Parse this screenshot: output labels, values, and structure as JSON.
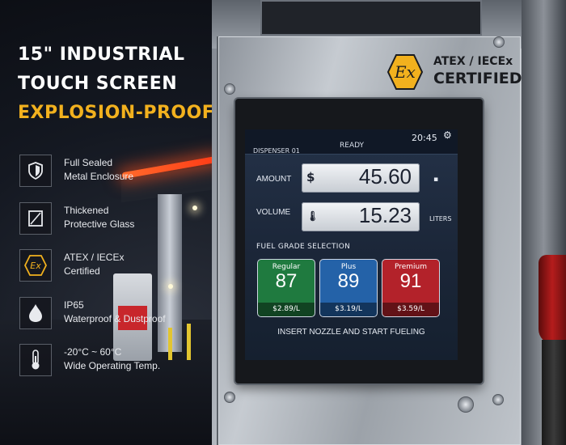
{
  "headline": {
    "line1": "15\" INDUSTRIAL",
    "line2": "TOUCH SCREEN",
    "line3": "EXPLOSION-PROOF"
  },
  "features": [
    {
      "icon": "shield-icon",
      "line1": "Full Sealed",
      "line2": "Metal Enclosure"
    },
    {
      "icon": "glass-icon",
      "line1": "Thickened",
      "line2": "Protective Glass"
    },
    {
      "icon": "ex-icon",
      "line1": "ATEX / IECEx",
      "line2": "Certified"
    },
    {
      "icon": "water-drop-icon",
      "line1": "IP65",
      "line2": "Waterproof & Dustproof"
    },
    {
      "icon": "thermometer-icon",
      "line1": "-20°C ~ 60°C",
      "line2": "Wide Operating Temp."
    }
  ],
  "certification": {
    "badge": "Ex",
    "line1": "ATEX / IECEx",
    "line2": "CERTIFIED"
  },
  "screen": {
    "status_bar": {
      "dispenser": "DISPENSER 01",
      "state": "READY",
      "time": "20:45",
      "settings_icon": "gear-icon"
    },
    "amount": {
      "label": "AMOUNT",
      "symbol": "$",
      "value": "45.60"
    },
    "volume": {
      "label": "VOLUME",
      "value": "15.23",
      "unit": "LITERS"
    },
    "grade_section_title": "FUEL GRADE SELECTION",
    "grades": [
      {
        "name": "Regular",
        "octane": "87",
        "price": "$2.89/L",
        "color": "#1f7a3f"
      },
      {
        "name": "Plus",
        "octane": "89",
        "price": "$3.19/L",
        "color": "#2462a8"
      },
      {
        "name": "Premium",
        "octane": "91",
        "price": "$3.59/L",
        "color": "#b3222a"
      }
    ],
    "instruction": "INSERT NOZZLE AND START FUELING"
  },
  "colors": {
    "accent": "#f2b11e",
    "ex_badge": "#f2b11e"
  }
}
